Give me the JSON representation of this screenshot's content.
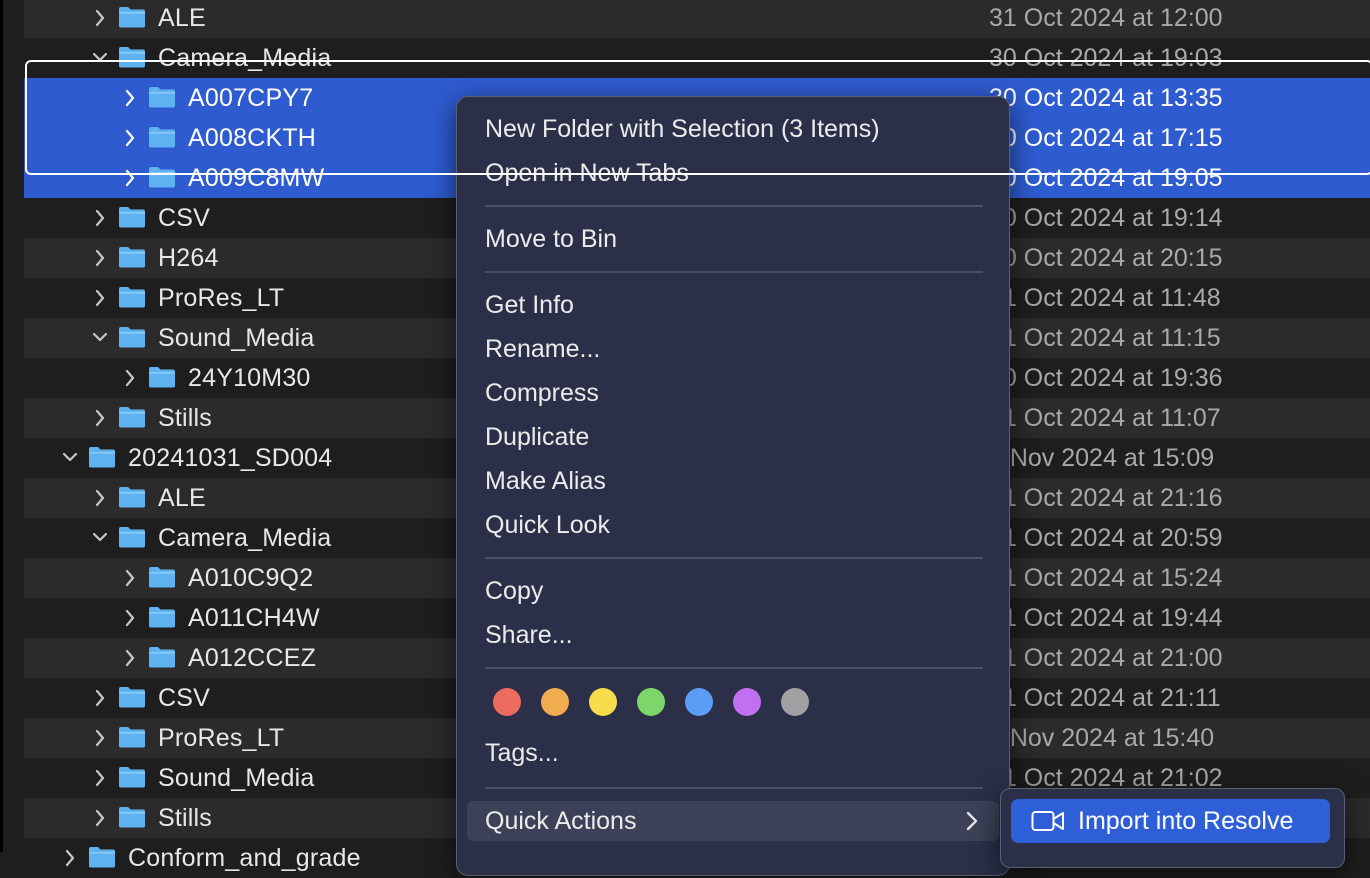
{
  "colors": {
    "selection": "#2e5bd0",
    "folder": "#5fb2f0",
    "menu_background": "#2b3048",
    "submenu_highlight": "#2f5fd6"
  },
  "rows": [
    {
      "name": "ALE",
      "date": "31 Oct 2024 at 12:00",
      "level": 2,
      "expanded": false,
      "stripe": true,
      "selected": false
    },
    {
      "name": "Camera_Media",
      "date": "30 Oct 2024 at 19:03",
      "level": 2,
      "expanded": true,
      "stripe": false,
      "selected": false
    },
    {
      "name": "A007CPY7",
      "date": "30 Oct 2024 at 13:35",
      "level": 3,
      "expanded": false,
      "stripe": false,
      "selected": true
    },
    {
      "name": "A008CKTH",
      "date": "30 Oct 2024 at 17:15",
      "level": 3,
      "expanded": false,
      "stripe": false,
      "selected": true
    },
    {
      "name": "A009C8MW",
      "date": "30 Oct 2024 at 19:05",
      "level": 3,
      "expanded": false,
      "stripe": false,
      "selected": true
    },
    {
      "name": "CSV",
      "date": "30 Oct 2024 at 19:14",
      "level": 2,
      "expanded": false,
      "stripe": false,
      "selected": false
    },
    {
      "name": "H264",
      "date": "30 Oct 2024 at 20:15",
      "level": 2,
      "expanded": false,
      "stripe": true,
      "selected": false
    },
    {
      "name": "ProRes_LT",
      "date": "31 Oct 2024 at 11:48",
      "level": 2,
      "expanded": false,
      "stripe": false,
      "selected": false
    },
    {
      "name": "Sound_Media",
      "date": "31 Oct 2024 at 11:15",
      "level": 2,
      "expanded": true,
      "stripe": true,
      "selected": false
    },
    {
      "name": "24Y10M30",
      "date": "30 Oct 2024 at 19:36",
      "level": 3,
      "expanded": false,
      "stripe": false,
      "selected": false
    },
    {
      "name": "Stills",
      "date": "31 Oct 2024 at 11:07",
      "level": 2,
      "expanded": false,
      "stripe": true,
      "selected": false
    },
    {
      "name": "20241031_SD004",
      "date": "1 Nov 2024 at 15:09",
      "level": 1,
      "expanded": true,
      "stripe": false,
      "selected": false
    },
    {
      "name": "ALE",
      "date": "31 Oct 2024 at 21:16",
      "level": 2,
      "expanded": false,
      "stripe": true,
      "selected": false
    },
    {
      "name": "Camera_Media",
      "date": "31 Oct 2024 at 20:59",
      "level": 2,
      "expanded": true,
      "stripe": false,
      "selected": false
    },
    {
      "name": "A010C9Q2",
      "date": "31 Oct 2024 at 15:24",
      "level": 3,
      "expanded": false,
      "stripe": true,
      "selected": false
    },
    {
      "name": "A011CH4W",
      "date": "31 Oct 2024 at 19:44",
      "level": 3,
      "expanded": false,
      "stripe": false,
      "selected": false
    },
    {
      "name": "A012CCEZ",
      "date": "31 Oct 2024 at 21:00",
      "level": 3,
      "expanded": false,
      "stripe": true,
      "selected": false
    },
    {
      "name": "CSV",
      "date": "31 Oct 2024 at 21:11",
      "level": 2,
      "expanded": false,
      "stripe": false,
      "selected": false
    },
    {
      "name": "ProRes_LT",
      "date": "1 Nov 2024 at 15:40",
      "level": 2,
      "expanded": false,
      "stripe": true,
      "selected": false
    },
    {
      "name": "Sound_Media",
      "date": "31 Oct 2024 at 21:02",
      "level": 2,
      "expanded": false,
      "stripe": false,
      "selected": false
    },
    {
      "name": "Stills",
      "date": "",
      "level": 2,
      "expanded": false,
      "stripe": true,
      "selected": false
    },
    {
      "name": "Conform_and_grade",
      "date": "",
      "level": 1,
      "expanded": false,
      "stripe": false,
      "selected": false
    }
  ],
  "context_menu": {
    "new_folder_with_selection": "New Folder with Selection (3 Items)",
    "open_in_new_tabs": "Open in New Tabs",
    "move_to_bin": "Move to Bin",
    "get_info": "Get Info",
    "rename": "Rename...",
    "compress": "Compress",
    "duplicate": "Duplicate",
    "make_alias": "Make Alias",
    "quick_look": "Quick Look",
    "copy": "Copy",
    "share": "Share...",
    "tags": "Tags...",
    "quick_actions": "Quick Actions",
    "tag_colors": [
      {
        "name": "red",
        "color": "#ec6a5e"
      },
      {
        "name": "orange",
        "color": "#f3ad51"
      },
      {
        "name": "yellow",
        "color": "#f7dc4b"
      },
      {
        "name": "green",
        "color": "#7ed66a"
      },
      {
        "name": "blue",
        "color": "#5b9cf5"
      },
      {
        "name": "purple",
        "color": "#c070f0"
      },
      {
        "name": "gray",
        "color": "#a1a1a4"
      }
    ]
  },
  "submenu": {
    "import_into_resolve": "Import into Resolve"
  }
}
